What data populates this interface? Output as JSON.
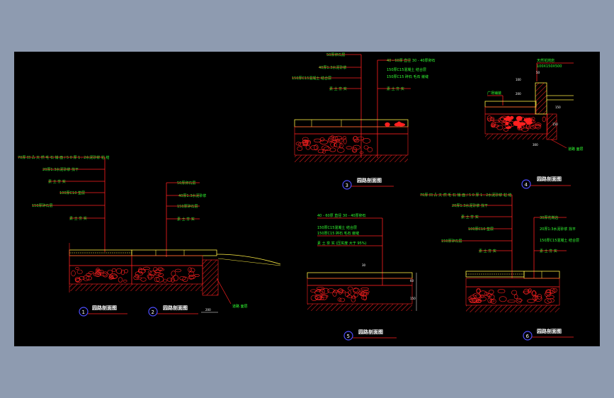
{
  "colors": {
    "background_outer": "#8e9bb0",
    "background_drawing": "#000000",
    "leader": "#ff2020",
    "label": "#33ff33",
    "paving": "#ffee44",
    "gravel": "#ff2020",
    "title": "#ffffff",
    "circle": "#4d4dff"
  },
  "details": [
    {
      "number": "1",
      "title": "园路剖面图",
      "labels": [
        "70厚 凹 凸 天 然 毛 石 铺 面 / 5 0 厚 1 : 2水泥砂浆  粘 结",
        "20厚1:3水泥砂浆 找平",
        "素 土 夯 实",
        "100厚C10 垫层",
        "150厚碎石层",
        "素 土 夯 实"
      ]
    },
    {
      "number": "2",
      "title": "园路剖面图",
      "labels": [
        "50厚卵石层",
        "40厚1:3水泥砂浆",
        "150厚碎石层",
        "素 土 夯 实"
      ],
      "dims": [
        "200"
      ],
      "callout": "道路 面层"
    },
    {
      "number": "3",
      "title": "园路剖面图",
      "labels": [
        "50厚卵石层",
        "40厚1:3水泥砂浆",
        "150厚C15混凝土 结合层",
        "素 土 夯 实"
      ],
      "labels_right": [
        "40 - 60厚 直径 30 - 40厚卵石",
        "150厚C15混凝土 结合层",
        "150厚C15 碎石 毛石 嵌缝",
        "素 土 夯 实"
      ]
    },
    {
      "number": "4",
      "title": "园路剖面图",
      "labels": [
        "天然花岗岩",
        "100X150X500",
        "广场铺装"
      ],
      "dims": [
        "100",
        "50",
        "200",
        "150",
        "300",
        "150"
      ],
      "callout": "道路 面层"
    },
    {
      "number": "5",
      "title": "园路剖面图",
      "labels": [
        "40 - 60厚 直径 30 - 40厚卵石",
        "150厚C15混凝土 结合层",
        "150厚C15 碎石 毛石 嵌缝",
        "素 土 夯 实 (压实度 大于 95%)"
      ],
      "dims": [
        "30",
        "60",
        "150"
      ]
    },
    {
      "number": "6",
      "title": "园路剖面图",
      "labels": [
        "70厚 凹 凸 天 然 毛 石 铺 面 / 5 0 厚 1 : 2水泥砂浆  粘 结",
        "20厚1:3水泥砂浆 找平",
        "素 土 夯 实",
        "100厚C10 垫层",
        "150厚碎石层",
        "素 土 夯 实"
      ],
      "labels_right": [
        "30厚花岗岩",
        "20厚1:3水泥砂浆 找平",
        "150厚C15混凝土 结合层",
        "素 土 夯 实"
      ]
    }
  ]
}
